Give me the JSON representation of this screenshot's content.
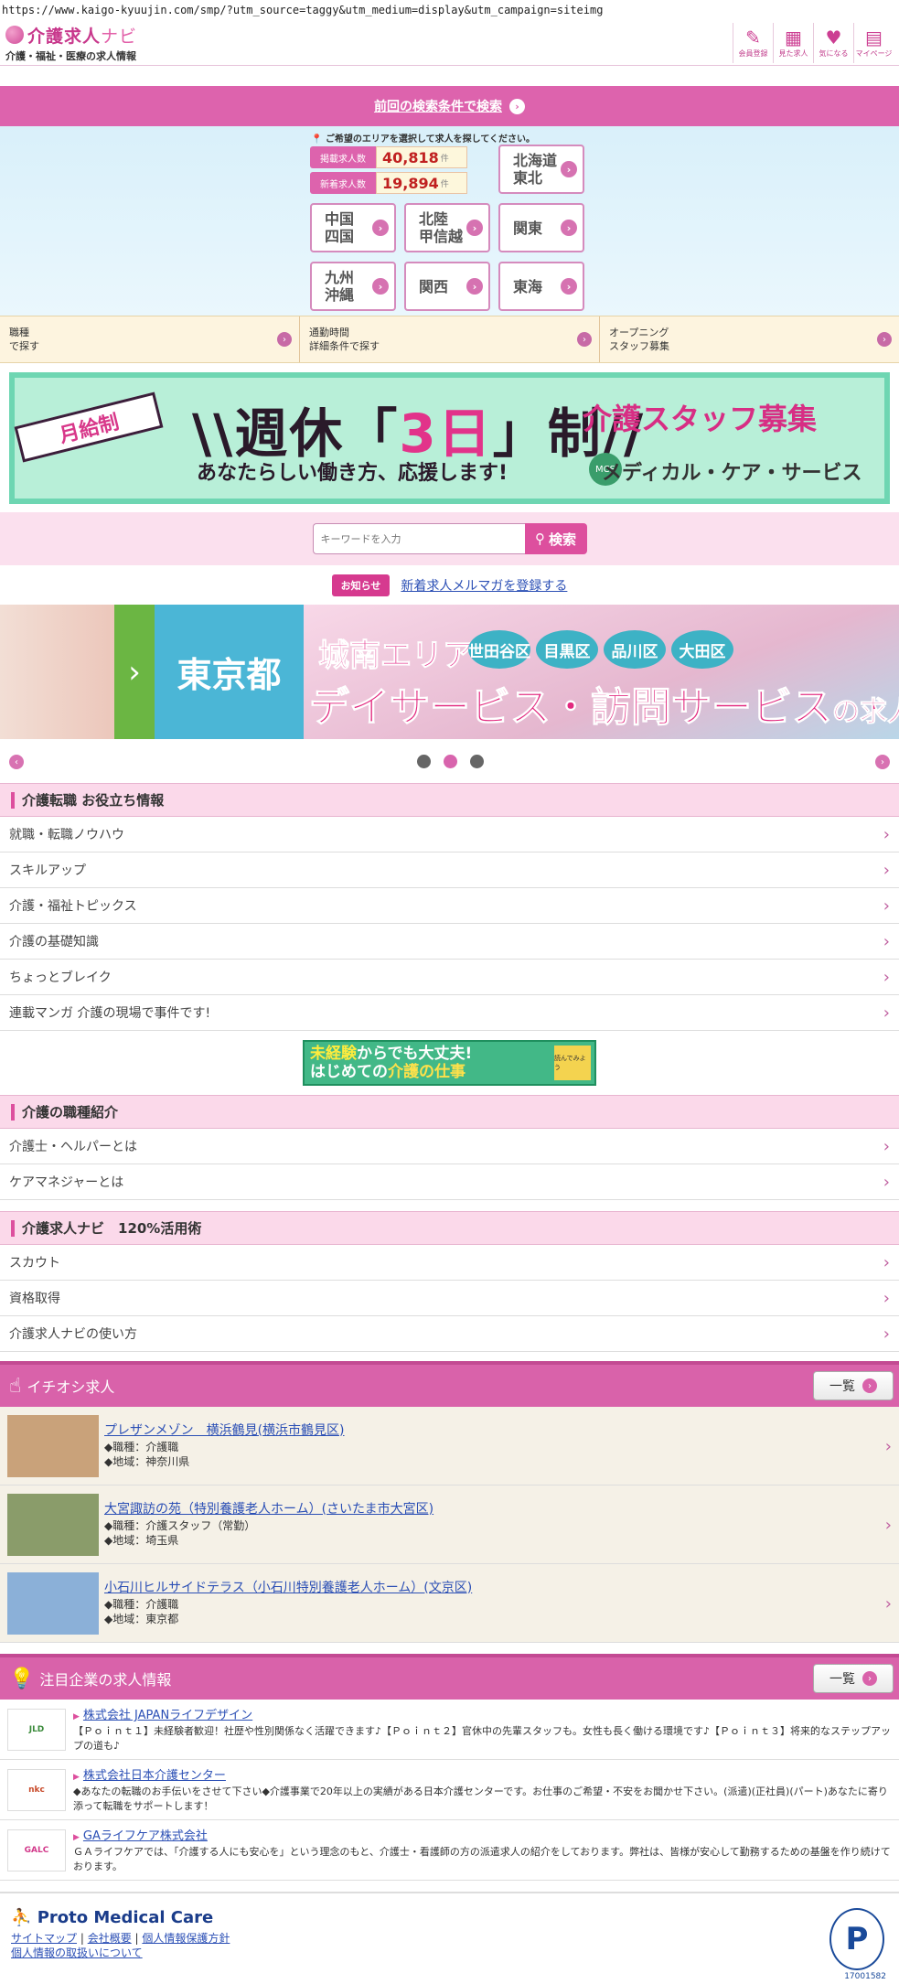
{
  "browser": {
    "url": "https://www.kaigo-kyuujin.com/smp/?utm_source=taggy&utm_medium=display&utm_campaign=siteimg"
  },
  "header": {
    "logo_main": "介護求人",
    "logo_navi": "ナビ",
    "logo_sub": "介護・福祉・医療の求人情報",
    "icons": [
      {
        "icon": "pencil-icon",
        "label": "会員登録"
      },
      {
        "icon": "calendar-icon",
        "label": "見た求人"
      },
      {
        "icon": "heart-icon",
        "label": "気になる"
      },
      {
        "icon": "mypage-icon",
        "label": "マイページ"
      }
    ]
  },
  "prev_search": {
    "label": "前回の検索条件で検索"
  },
  "area": {
    "note": "ご希望のエリアを選択して求人を探してください。",
    "stats": [
      {
        "label": "掲載求人数",
        "value": "40,818",
        "unit": "件"
      },
      {
        "label": "新着求人数",
        "value": "19,894",
        "unit": "件"
      }
    ],
    "buttons": {
      "hokkaido": "北海道\n東北",
      "chugoku": "中国\n四国",
      "hokuriku": "北陸\n甲信越",
      "kanto": "関東",
      "kyushu": "九州\n沖縄",
      "kansai": "関西",
      "tokai": "東海"
    }
  },
  "search_tabs": [
    {
      "label": "職種\nで探す"
    },
    {
      "label": "通勤時間\n詳細条件で探す"
    },
    {
      "label": "オープニング\nスタッフ募集"
    }
  ],
  "banner": {
    "ribbon": "月給制",
    "head_a": "週休「",
    "head_b": "3日",
    "head_c": "」制",
    "sub": "あなたらしい働き方、応援します!",
    "right": "介護スタッフ募集",
    "company": "メディカル・ケア・サービス",
    "logo": "MCS"
  },
  "keyword": {
    "placeholder": "キーワードを入力",
    "button": "検索"
  },
  "news": {
    "badge": "お知らせ",
    "link": "新着求人メルマガを登録する"
  },
  "slider": {
    "region": "東京都",
    "area": "城南エリア",
    "wards": [
      "世田谷区",
      "目黒区",
      "品川区",
      "大田区"
    ],
    "title": "デイサービス・訪問サービス",
    "title_suffix": "の求人",
    "dots": 3,
    "active_dot": 2
  },
  "section_tips": {
    "title": "介護転職 お役立ち情報",
    "items": [
      "就職・転職ノウハウ",
      "スキルアップ",
      "介護・福祉トピックス",
      "介護の基礎知識",
      "ちょっとブレイク",
      "連載マンガ 介護の現場で事件です!"
    ]
  },
  "mid_banner": {
    "line1_a": "未経験",
    "line1_b": "からでも大丈夫!",
    "line2_a": "はじめての",
    "line2_b": "介護の仕事",
    "book": "読んでみよう"
  },
  "section_jobs": {
    "title": "介護の職種紹介",
    "items": [
      "介護士・ヘルパーとは",
      "ケアマネジャーとは"
    ]
  },
  "section_guide": {
    "title": "介護求人ナビ　120%活用術",
    "items": [
      "スカウト",
      "資格取得",
      "介護求人ナビの使い方"
    ]
  },
  "featured": {
    "title": "イチオシ求人",
    "more": "一覧",
    "jobs": [
      {
        "title": "プレザンメゾン　横浜鶴見(横浜市鶴見区)",
        "type": "◆職種：介護職",
        "region": "◆地域：神奈川県",
        "thumb": "#c9a27a"
      },
      {
        "title": "大宮諏訪の苑（特別養護老人ホーム）(さいたま市大宮区)",
        "type": "◆職種：介護スタッフ（常勤）",
        "region": "◆地域：埼玉県",
        "thumb": "#8a9c6a"
      },
      {
        "title": "小石川ヒルサイドテラス（小石川特別養護老人ホーム）(文京区)",
        "type": "◆職種：介護職",
        "region": "◆地域：東京都",
        "thumb": "#8bb0d8"
      }
    ]
  },
  "companies": {
    "title": "注目企業の求人情報",
    "more": "一覧",
    "items": [
      {
        "name": "株式会社 JAPANライフデザイン",
        "logo": "JLD",
        "logo_color": "#3a8a3a",
        "desc": "【Ｐｏｉｎｔ１】未経験者歓迎！社歴や性別関係なく活躍できます♪【Ｐｏｉｎｔ２】官休中の先輩スタッフも。女性も長く働ける環境です♪【Ｐｏｉｎｔ３】将来的なステップアップの道も♪"
      },
      {
        "name": "株式会社日本介護センター",
        "logo": "nkc",
        "logo_color": "#c84a2a",
        "desc": "◆あなたの転職のお手伝いをさせて下さい◆介護事業で20年以上の実績がある日本介護センターです。お仕事のご希望・不安をお聞かせ下さい。(派遣)(正社員)(パート)あなたに寄り添って転職をサポートします！"
      },
      {
        "name": "GAライフケア株式会社",
        "logo": "GALC",
        "logo_color": "#d2388a",
        "desc": "ＧＡライフケアでは、「介護する人にも安心を」という理念のもと、介護士・看護師の方の派遣求人の紹介をしております。弊社は、皆様が安心して勤務するための基盤を作り続けております。"
      }
    ]
  },
  "footer": {
    "logo": "Proto Medical Care",
    "links": [
      "サイトマップ",
      "会社概要",
      "個人情報保護方針",
      "個人情報の取扱いについて"
    ],
    "pmark_number": "17001582"
  }
}
